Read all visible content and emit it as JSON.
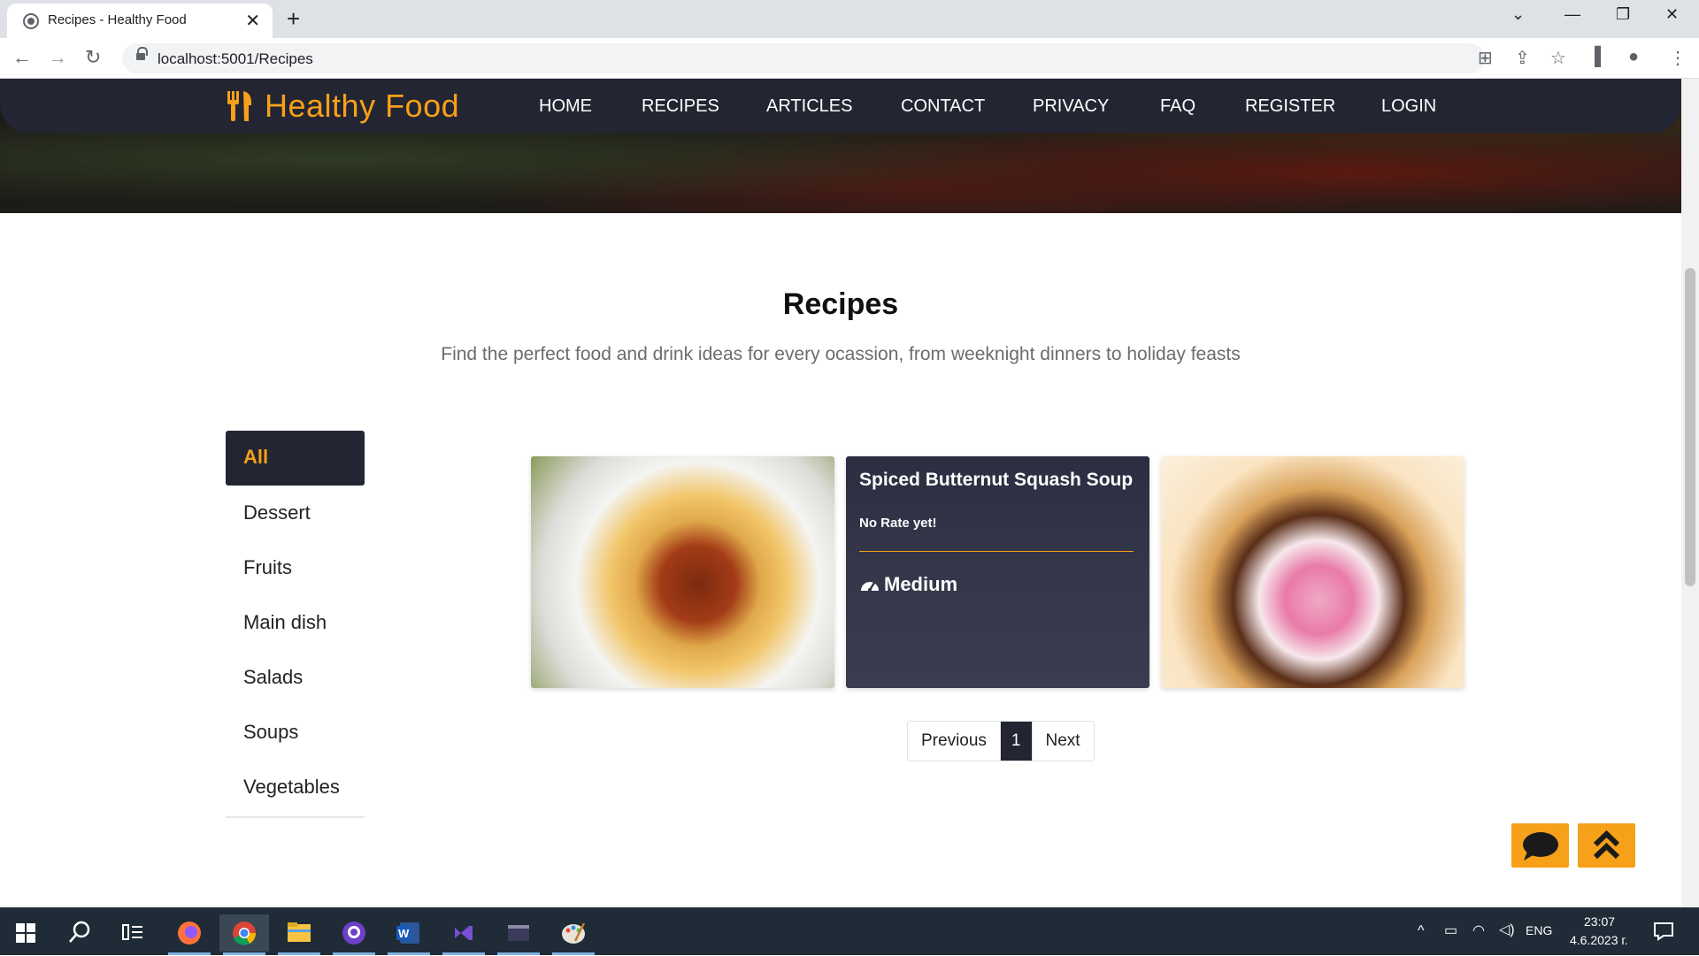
{
  "browser": {
    "tab_title": "Recipes - Healthy Food",
    "url": "localhost:5001/Recipes"
  },
  "site": {
    "brand": "Healthy Food",
    "nav": [
      "HOME",
      "RECIPES",
      "ARTICLES",
      "CONTACT",
      "PRIVACY",
      "FAQ",
      "REGISTER",
      "LOGIN"
    ]
  },
  "main": {
    "title": "Recipes",
    "subtitle": "Find the perfect food and drink ideas for every ocassion, from weeknight dinners to holiday feasts",
    "categories": [
      "All",
      "Dessert",
      "Fruits",
      "Main dish",
      "Salads",
      "Soups",
      "Vegetables"
    ],
    "active_category": "All",
    "cards": [
      {
        "image": "spaghetti-bolognese-image"
      },
      {
        "title": "Spiced Butternut Squash Soup",
        "rating": "No Rate yet!",
        "difficulty": "Medium"
      },
      {
        "image": "ice-cream-dessert-image"
      }
    ],
    "pagination": {
      "previous": "Previous",
      "page": "1",
      "next": "Next"
    }
  },
  "taskbar": {
    "language": "ENG",
    "time": "23:07",
    "date": "4.6.2023 г."
  },
  "colors": {
    "accent": "#f7a019",
    "navbar": "#232532"
  }
}
